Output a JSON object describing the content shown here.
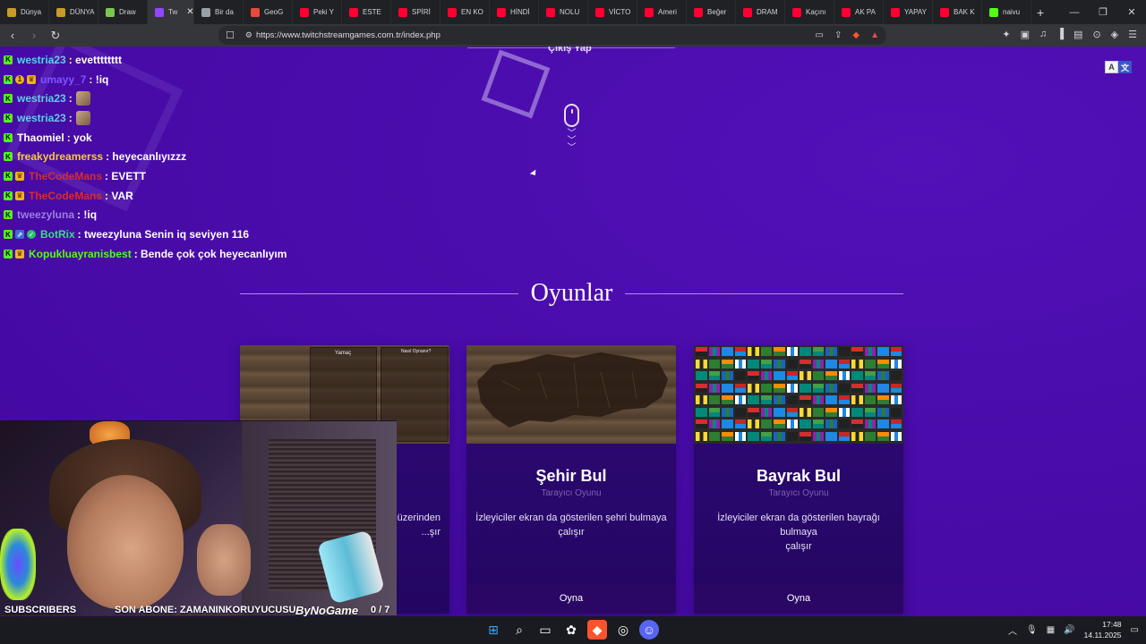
{
  "tabs": [
    {
      "label": "Dünya",
      "color": "#c89a2a"
    },
    {
      "label": "DÜNYA",
      "color": "#c89a2a"
    },
    {
      "label": "Draw",
      "color": "#7ac74f"
    },
    {
      "label": "Tw",
      "color": "#9146ff",
      "active": true
    },
    {
      "label": "Bir da",
      "color": "#9aa0a6"
    },
    {
      "label": "GeoG",
      "color": "#e84a3b"
    },
    {
      "label": "Peki Y",
      "color": "#ff0033"
    },
    {
      "label": "ESTE",
      "color": "#ff0033"
    },
    {
      "label": "SPİRİ",
      "color": "#ff0033"
    },
    {
      "label": "EN KO",
      "color": "#ff0033"
    },
    {
      "label": "HİNDİ",
      "color": "#ff0033"
    },
    {
      "label": "NOLU",
      "color": "#ff0033"
    },
    {
      "label": "VİCTO",
      "color": "#ff0033"
    },
    {
      "label": "Ameri",
      "color": "#ff0033"
    },
    {
      "label": "Beğer",
      "color": "#ff0033"
    },
    {
      "label": "DRAM",
      "color": "#ff0033"
    },
    {
      "label": "Kaçını",
      "color": "#ff0033"
    },
    {
      "label": "AK PA",
      "color": "#ff0033"
    },
    {
      "label": "YAPAY",
      "color": "#ff0033"
    },
    {
      "label": "BAK K",
      "color": "#ff0033"
    },
    {
      "label": "naivu",
      "color": "#53fc18"
    }
  ],
  "toolbar": {
    "url": "https://www.twitchstreamgames.com.tr/index.php"
  },
  "page": {
    "logout_label": "Çıkış Yap",
    "translate_a": "A",
    "translate_b": "文",
    "games_heading": "Oyunlar"
  },
  "chat": [
    {
      "badges": [
        "k"
      ],
      "user": "westria23",
      "user_color": "#5ad1e6",
      "text": ": evetttttttt",
      "emote": false
    },
    {
      "badges": [
        "k",
        "one",
        "crown"
      ],
      "user": "umayy_7",
      "user_color": "#7c55ff",
      "text": ": !iq",
      "emote": false
    },
    {
      "badges": [
        "k"
      ],
      "user": "westria23",
      "user_color": "#5ad1e6",
      "text": ":",
      "emote": true
    },
    {
      "badges": [
        "k"
      ],
      "user": "westria23",
      "user_color": "#5ad1e6",
      "text": ":",
      "emote": true
    },
    {
      "badges": [
        "k"
      ],
      "user": "Thaomiel",
      "user_color": "#ffffff",
      "text": ": yok",
      "emote": false
    },
    {
      "badges": [
        "k"
      ],
      "user": "freakydreamerss",
      "user_color": "#f5c842",
      "text": ": heyecanlıyızzz",
      "emote": false
    },
    {
      "badges": [
        "k",
        "crown"
      ],
      "user": "TheCodeMans",
      "user_color": "#d32f2f",
      "text": ": EVETT",
      "emote": false
    },
    {
      "badges": [
        "k",
        "crown"
      ],
      "user": "TheCodeMans",
      "user_color": "#d32f2f",
      "text": ": VAR",
      "emote": false
    },
    {
      "badges": [
        "k"
      ],
      "user": "tweezyluna",
      "user_color": "#9b7fe0",
      "text": ": !iq",
      "emote": false
    },
    {
      "badges": [
        "k",
        "bot",
        "check"
      ],
      "user": "BotRix",
      "user_color": "#3ddc84",
      "text": ": tweezyluna Senin iq seviyen 116",
      "emote": false
    },
    {
      "badges": [
        "k",
        "crown"
      ],
      "user": "Kopukluayranisbest",
      "user_color": "#53fc18",
      "text": ": Bende çok çok heyecanlıyım",
      "emote": false
    }
  ],
  "cards": [
    {
      "title": "",
      "subtitle": "",
      "desc_line1": "...at üzerinden",
      "desc_line2": "...şır",
      "play": "",
      "thumb": "game",
      "thumb_title": "Yamaç",
      "thumb_panel": "Nasıl Oynanır?"
    },
    {
      "title": "Şehir Bul",
      "subtitle": "Tarayıcı Oyunu",
      "desc_line1": "İzleyiciler ekran da gösterilen şehri bulmaya",
      "desc_line2": "çalışır",
      "play": "Oyna",
      "thumb": "map"
    },
    {
      "title": "Bayrak Bul",
      "subtitle": "Tarayıcı Oyunu",
      "desc_line1": "İzleyiciler ekran da gösterilen bayrağı bulmaya",
      "desc_line2": "çalışır",
      "play": "Oyna",
      "thumb": "flags"
    }
  ],
  "overlay": {
    "subscribers_label": "SUBSCRIBERS",
    "last_sub": "SON ABONE: ZAMANINKORUYUCUSU",
    "sponsor": "ByNoGame",
    "sub_current": "0",
    "sub_goal": "7",
    "sub_progress": 0.0
  },
  "taskbar": {
    "time": "17:48",
    "date": "14.11.2025"
  },
  "colors": {
    "page_bg": "#4a0eaf",
    "card_bg": "#2f0a78",
    "kick_green": "#53fc18"
  }
}
